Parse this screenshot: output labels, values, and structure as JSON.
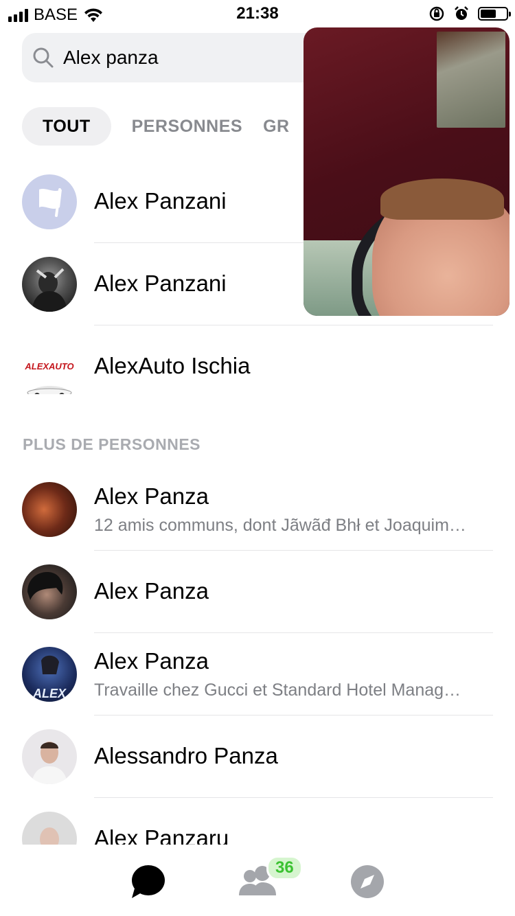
{
  "status_bar": {
    "carrier": "BASE",
    "time": "21:38"
  },
  "search": {
    "value": "Alex panza"
  },
  "tabs": [
    {
      "label": "TOUT",
      "active": true
    },
    {
      "label": "PERSONNES",
      "active": false
    },
    {
      "label": "GR",
      "active": false
    }
  ],
  "top_results": [
    {
      "name": "Alex Panzani",
      "avatar": "flag-icon"
    },
    {
      "name": "Alex Panzani",
      "avatar": "photo"
    },
    {
      "name": "AlexAuto Ischia",
      "avatar": "car-logo"
    }
  ],
  "section_title": "PLUS DE PERSONNES",
  "more_people": [
    {
      "name": "Alex Panza",
      "subtitle": "12 amis communs, dont Jãwãđ Bhł et Joaquim…"
    },
    {
      "name": "Alex Panza",
      "subtitle": ""
    },
    {
      "name": "Alex Panza",
      "subtitle": "Travaille chez Gucci et Standard Hotel Manag…"
    },
    {
      "name": "Alessandro Panza",
      "subtitle": ""
    },
    {
      "name": "Alex Panzaru",
      "subtitle": ""
    }
  ],
  "logo_text": "ALEXAUTO",
  "avatar_text_alex": "ALEX",
  "bottom_nav": {
    "items": [
      "chat-bubble-icon",
      "people-icon",
      "compass-icon"
    ],
    "people_badge": "36"
  },
  "colors": {
    "badge_text": "#3cc232",
    "badge_bg": "#d6f5cf",
    "muted": "#888a8f"
  }
}
